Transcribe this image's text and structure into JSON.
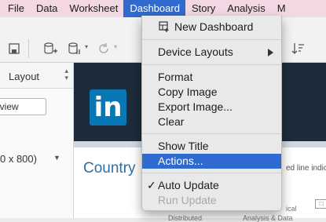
{
  "menubar": {
    "items": [
      {
        "label": "File"
      },
      {
        "label": "Data"
      },
      {
        "label": "Worksheet"
      },
      {
        "label": "Dashboard"
      },
      {
        "label": "Story"
      },
      {
        "label": "Analysis"
      },
      {
        "label": "M"
      }
    ]
  },
  "left_pane": {
    "tab_label": "Layout",
    "preview_label": "eview",
    "size_value": "0 x 800)"
  },
  "canvas": {
    "logo_text": "in",
    "title": "Country",
    "right_fragment": "ed line indic",
    "row1_a": "ical",
    "row2_a": "Distributed",
    "row2_b": "Analysis & Data"
  },
  "dashboard_menu": {
    "new_dashboard": "New Dashboard",
    "device_layouts": "Device Layouts",
    "format": "Format",
    "copy_image": "Copy Image",
    "export_image": "Export Image...",
    "clear": "Clear",
    "show_title": "Show Title",
    "actions": "Actions...",
    "auto_update": "Auto Update",
    "run_update": "Run Update",
    "auto_update_checked": true,
    "highlighted": "Actions..."
  },
  "colors": {
    "menubar_bg": "#f3d8e4",
    "highlight": "#2f6ad0",
    "banner": "#1d2c3b",
    "linkedin_blue": "#0a77b5",
    "title_blue": "#2d6fa3"
  }
}
